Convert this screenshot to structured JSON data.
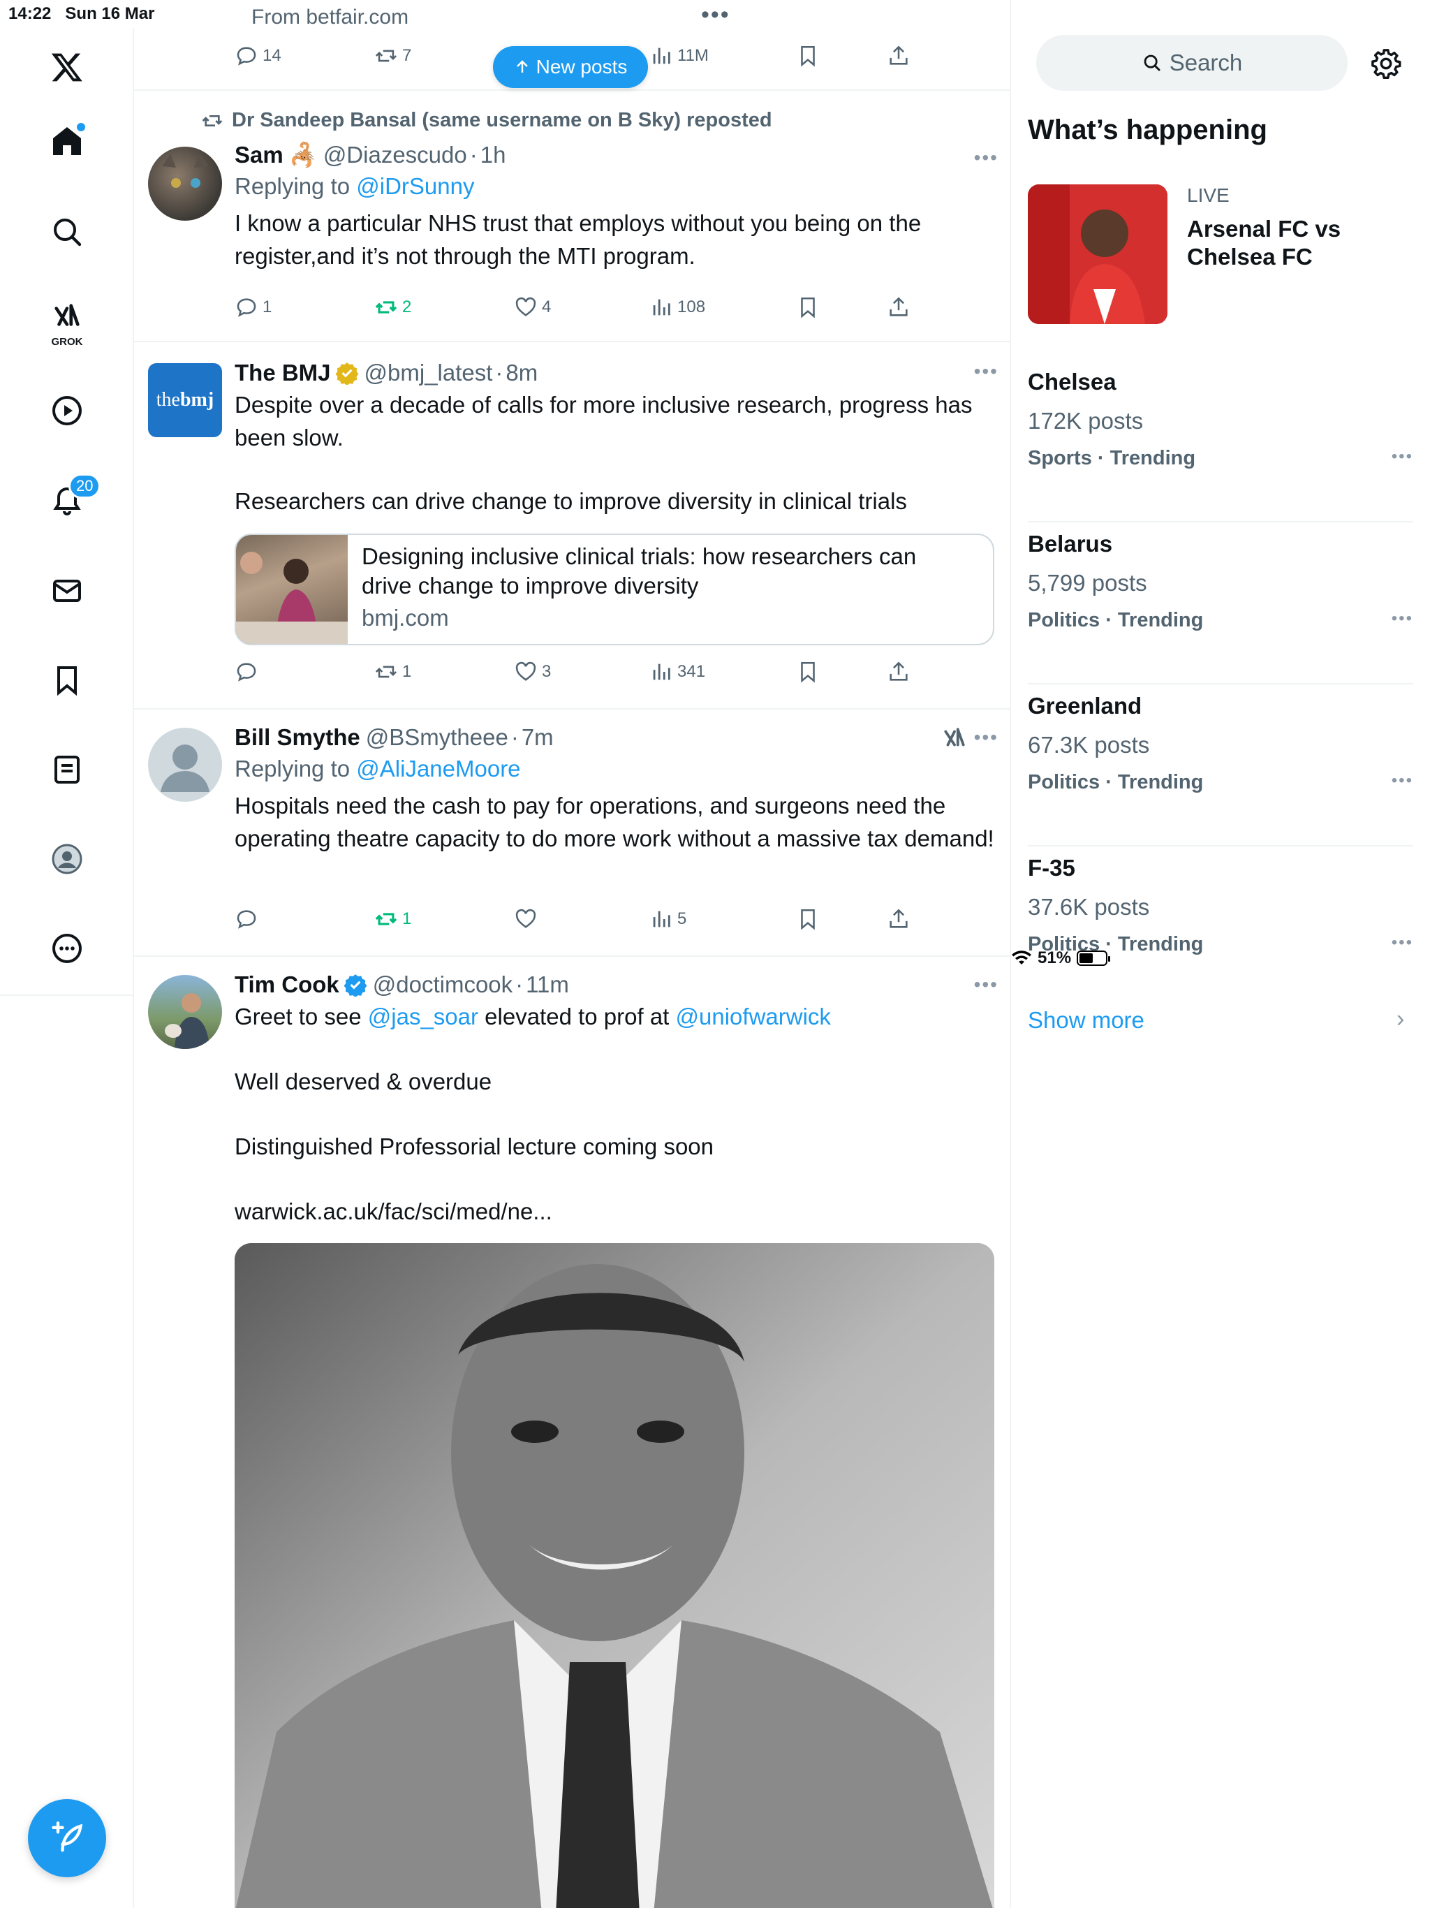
{
  "status_bar": {
    "time": "14:22",
    "date": "Sun 16 Mar",
    "battery": "51%"
  },
  "nav": {
    "notifications_badge": "20",
    "grok_label": "GROK"
  },
  "ad_post": {
    "source": "From betfair.com",
    "replies": "14",
    "reposts": "7",
    "views": "11M"
  },
  "new_posts_label": "New posts",
  "posts": [
    {
      "repost_by": "Dr Sandeep Bansal (same username on B Sky) reposted",
      "name": "Sam",
      "name_emoji": "🦂",
      "handle": "@Diazescudo",
      "time": "1h",
      "replying_prefix": "Replying to ",
      "replying_to": "@iDrSunny",
      "text": "I know a particular NHS trust that employs without you being on the register,and it’s not through the MTI program.",
      "replies": "1",
      "reposts": "2",
      "likes": "4",
      "views": "108"
    },
    {
      "name": "The BMJ",
      "avatar_text_a": "the",
      "avatar_text_b": "bmj",
      "handle": "@bmj_latest",
      "time": "8m",
      "text_1": "Despite over a decade of calls for more inclusive research, progress has been slow.",
      "text_2": "Researchers can drive change to improve diversity in clinical trials",
      "card_title": "Designing inclusive clinical trials: how researchers can drive change to improve diversity",
      "card_domain": "bmj.com",
      "replies": "",
      "reposts": "1",
      "likes": "3",
      "views": "341"
    },
    {
      "name": "Bill Smythe",
      "handle": "@BSmytheee",
      "time": "7m",
      "replying_prefix": "Replying to ",
      "replying_to": "@AliJaneMoore",
      "text": "Hospitals need the cash to pay for operations, and surgeons need the operating theatre capacity to do more work without a massive tax demand!",
      "replies": "",
      "reposts": "1",
      "likes": "",
      "views": "5"
    },
    {
      "name": "Tim Cook",
      "handle": "@doctimcook",
      "time": "11m",
      "text_a": "Greet to see ",
      "mention_1": "@jas_soar",
      "text_b": " elevated to prof at ",
      "mention_2": "@uniofwarwick",
      "text_2": "Well deserved & overdue",
      "text_3": "Distinguished Professorial lecture coming soon",
      "url": "warwick.ac.uk/fac/sci/med/ne..."
    }
  ],
  "sidebar": {
    "search_placeholder": "Search",
    "heading": "What’s happening",
    "live": {
      "label": "LIVE",
      "title": "Arsenal FC vs Chelsea FC"
    },
    "trends": [
      {
        "name": "Chelsea",
        "count": "172K posts",
        "category": "Sports · Trending"
      },
      {
        "name": "Belarus",
        "count": "5,799 posts",
        "category": "Politics · Trending"
      },
      {
        "name": "Greenland",
        "count": "67.3K posts",
        "category": "Politics · Trending"
      },
      {
        "name": "F-35",
        "count": "37.6K posts",
        "category": "Politics · Trending"
      }
    ],
    "show_more": "Show more"
  },
  "colors": {
    "accent": "#1d9bf0",
    "repost_green": "#00ba7c",
    "muted": "#536471",
    "border": "#eff3f4"
  }
}
